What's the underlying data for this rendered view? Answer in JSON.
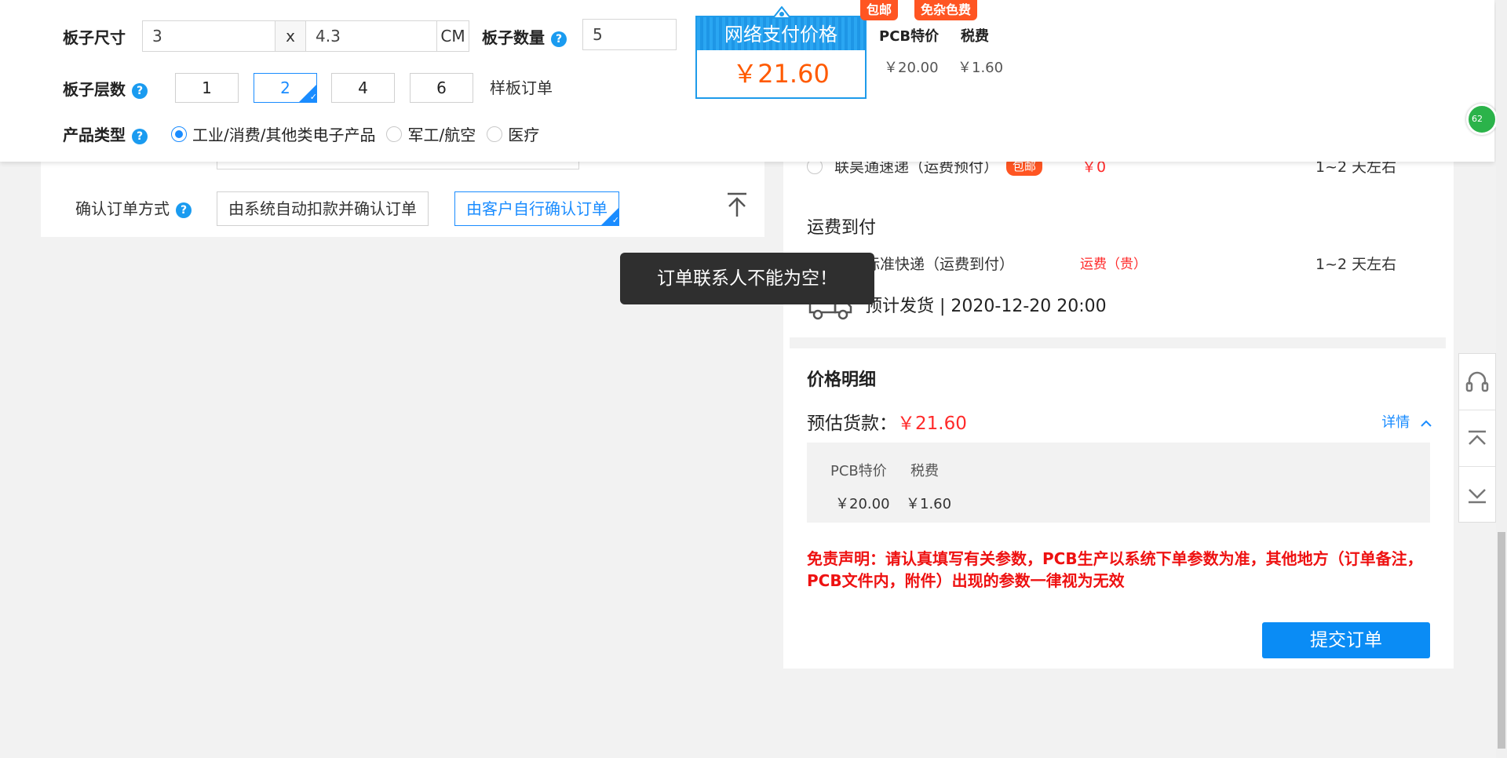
{
  "config": {
    "size_label": "板子尺寸",
    "width_value": "3",
    "times_symbol": "x",
    "height_value": "4.3",
    "unit": "CM",
    "quantity_label": "板子数量",
    "quantity_value": "5",
    "help_symbol": "?",
    "layers_label": "板子层数",
    "layers": [
      "1",
      "2",
      "4",
      "6"
    ],
    "selected_layer": "2",
    "sample_order_label": "样板订单",
    "product_type_label": "产品类型",
    "product_types": [
      "工业/消费/其他类电子产品",
      "军工/航空",
      "医疗"
    ],
    "selected_product_type": "工业/消费/其他类电子产品"
  },
  "payment": {
    "title": "网络支付价格",
    "amount": "￥21.60",
    "tags": [
      "包邮",
      "免杂色费"
    ],
    "breakdown_headers": [
      "PCB特价",
      "税费"
    ],
    "breakdown_values": [
      "￥20.00",
      "￥1.60"
    ]
  },
  "left_panel": {
    "confirm_label": "确认订单方式",
    "options": [
      "由系统自动扣款并确认订单",
      "由客户自行确认订单"
    ],
    "selected_option": "由客户自行确认订单"
  },
  "shipping": {
    "partial_row": {
      "name": "联昊通速递（运费预付）",
      "badge": "包邮",
      "price": "￥0",
      "time": "1~2 天左右"
    },
    "collect_title": "运费到付",
    "collect_row": {
      "name": "顺丰标准快递（运费到付）",
      "price": "运费（贵）",
      "time": "1~2 天左右"
    },
    "eta": "预计发货 | 2020-12-20 20:00"
  },
  "price_detail": {
    "title": "价格明细",
    "estimate_label": "预估货款：",
    "estimate_value": "￥21.60",
    "detail_link": "详情",
    "headers": [
      "PCB特价",
      "税费"
    ],
    "values": [
      "￥20.00",
      "￥1.60"
    ]
  },
  "disclaimer": "免责声明：请认真填写有关参数，PCB生产以系统下单参数为准，其他地方（订单备注，PCB文件内，附件）出现的参数一律视为无效",
  "submit_label": "提交订单",
  "toast": "订单联系人不能为空！",
  "floating_badge": "62",
  "colors": {
    "accent": "#1a8cff",
    "price_orange": "#ff5a00",
    "warning_red": "#ee1111",
    "submit_blue": "#0a8cf5"
  },
  "icons": [
    "help-icon",
    "truck-clock-icon",
    "headset-icon",
    "scroll-top-icon",
    "scroll-bottom-icon",
    "back-to-top-icon",
    "chevron-up-icon"
  ]
}
